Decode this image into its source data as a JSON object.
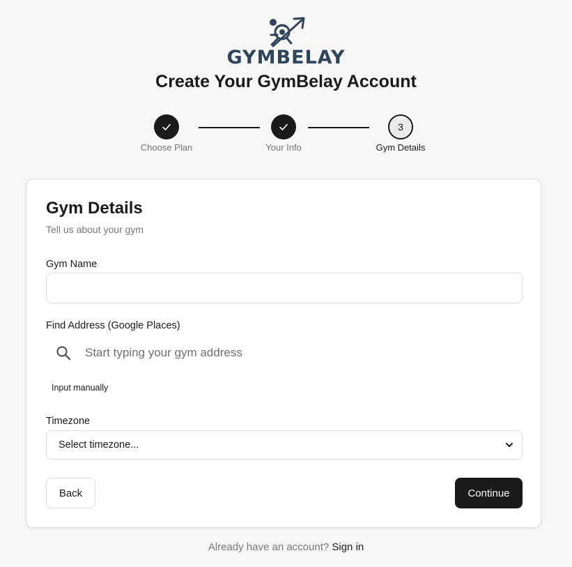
{
  "brand": {
    "logo_text": "GYMBELAY",
    "logo_icon": "climber-arrow-icon",
    "color": "#2f455c"
  },
  "page_title": "Create Your GymBelay Account",
  "stepper": {
    "steps": [
      {
        "label": "Choose Plan",
        "status": "complete",
        "number": "1"
      },
      {
        "label": "Your Info",
        "status": "complete",
        "number": "2"
      },
      {
        "label": "Gym Details",
        "status": "current",
        "number": "3"
      }
    ]
  },
  "form": {
    "title": "Gym Details",
    "subtitle": "Tell us about your gym",
    "gym_name": {
      "label": "Gym Name",
      "value": "",
      "placeholder": ""
    },
    "address": {
      "label": "Find Address (Google Places)",
      "placeholder": "Start typing your gym address",
      "icon": "search-icon"
    },
    "manual_link": "Input manually",
    "timezone": {
      "label": "Timezone",
      "selected": "Select timezone..."
    },
    "back_label": "Back",
    "continue_label": "Continue"
  },
  "footer": {
    "prompt": "Already have an account?",
    "link": "Sign in"
  },
  "colors": {
    "primary": "#1c1a19",
    "muted_text": "#7a7673",
    "border": "#dddddd",
    "background": "#f7f7f7"
  }
}
